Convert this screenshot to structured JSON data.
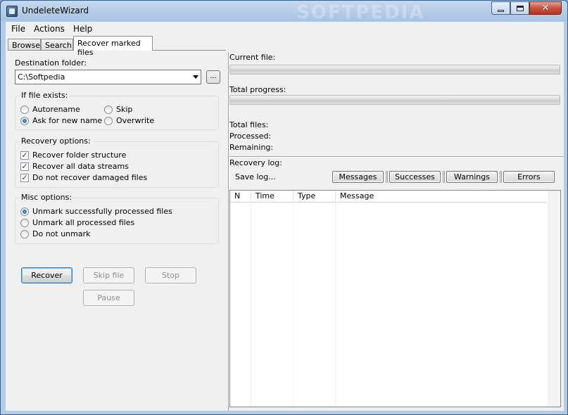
{
  "window": {
    "title": "UndeleteWizard",
    "watermark": "SOFTPEDIA"
  },
  "menu": {
    "file": "File",
    "actions": "Actions",
    "help": "Help"
  },
  "tabs": [
    {
      "label": "Browse"
    },
    {
      "label": "Search"
    },
    {
      "label": "Recover marked files"
    }
  ],
  "destination": {
    "label": "Destination folder:",
    "value": "C:\\Softpedia",
    "browse_label": "..."
  },
  "if_file_exists": {
    "title": "If file exists:",
    "options": [
      {
        "label": "Autorename",
        "selected": false
      },
      {
        "label": "Skip",
        "selected": false
      },
      {
        "label": "Ask for new name",
        "selected": true
      },
      {
        "label": "Overwrite",
        "selected": false
      }
    ]
  },
  "recovery_options": {
    "title": "Recovery options:",
    "items": [
      {
        "label": "Recover folder structure",
        "checked": true
      },
      {
        "label": "Recover all data streams",
        "checked": true
      },
      {
        "label": "Do not recover damaged files",
        "checked": true
      }
    ]
  },
  "misc_options": {
    "title": "Misc options:",
    "options": [
      {
        "label": "Unmark successfully processed files",
        "selected": true
      },
      {
        "label": "Unmark all processed files",
        "selected": false
      },
      {
        "label": "Do not unmark",
        "selected": false
      }
    ]
  },
  "actions": {
    "recover": "Recover",
    "skip_file": "Skip file",
    "stop": "Stop",
    "pause": "Pause"
  },
  "progress": {
    "current_file_label": "Current file:",
    "current_file_progress": 0,
    "total_progress_label": "Total progress:",
    "total_progress": 0
  },
  "stats": {
    "total_files_label": "Total files:",
    "processed_label": "Processed:",
    "remaining_label": "Remaining:"
  },
  "log": {
    "label": "Recovery log:",
    "save_label": "Save log...",
    "filters": [
      "Messages",
      "Successes",
      "Warnings",
      "Errors"
    ],
    "columns": [
      "N",
      "Time",
      "Type",
      "Message"
    ]
  }
}
